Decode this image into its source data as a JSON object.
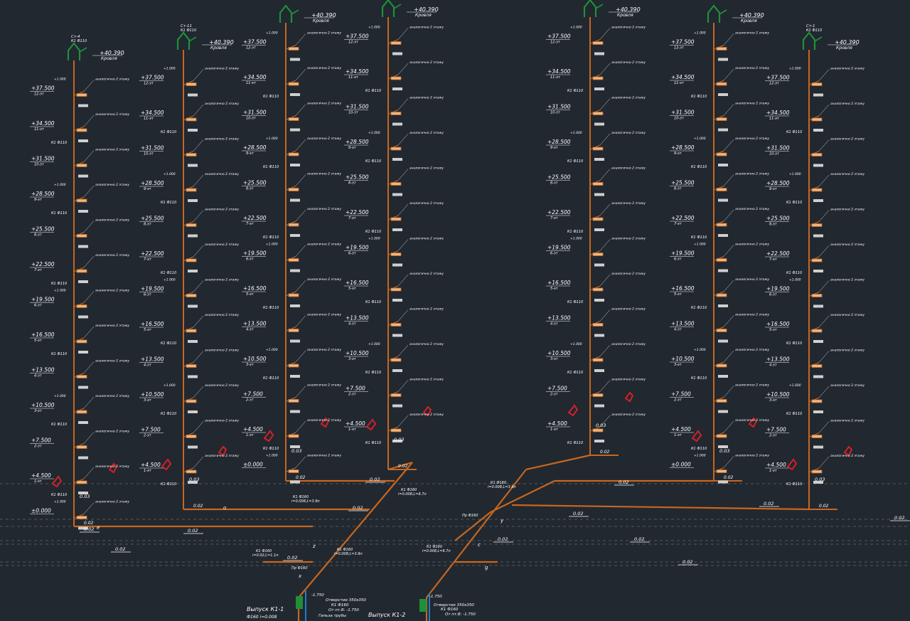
{
  "drawing": {
    "background": "#212830",
    "pipe_color": "#c8661e",
    "equipment_color": "#d42027",
    "vent_color": "#1f8f3a",
    "text_color": "#ffffff",
    "dim_color": "#bdbdbd"
  },
  "level_labels": [
    "+40.390",
    "+37.500",
    "+34.500",
    "+31.500",
    "+28.500",
    "+25.500",
    "+22.500",
    "+19.500",
    "+16.500",
    "+13.500",
    "+10.500",
    "+7.500",
    "+4.500",
    "±0.000"
  ],
  "roof_caption": "Кровля",
  "floor_captions": [
    "12-эт",
    "11-эт",
    "10-эт",
    "9-эт",
    "8-эт",
    "7-эт",
    "6-эт",
    "5-эт",
    "4-эт",
    "3-эт",
    "2-эт",
    "1-эт"
  ],
  "pipe_label": "К1 Ф110",
  "pipe_label_small": "К1 Ф50",
  "connection_note": "аналогично 2 этажу",
  "riser_tags": [
    "Ст-4",
    "Ст-11",
    "Ст-1"
  ],
  "riser_size": "К1 Ф110",
  "floor_mark": "+1.000",
  "slope_labels": [
    "0.02",
    "0.03"
  ],
  "outlet_1": {
    "title": "Выпуск К1-1",
    "size": "Ф160 i=0.008"
  },
  "outlet_2": {
    "title": "Выпуск К1-2",
    "size": "Ф160 i=0.008"
  },
  "outlet_notes": [
    "Отверстие 350х350",
    "К1 Ф160",
    "От пт.В: -1.750",
    "Гильза трубы",
    "-1.750"
  ],
  "branch_notes": [
    "К1 Ф160",
    "i=0.008,L=3.9п",
    "i=0.008,L=6.7п",
    "i=0.02,L=1.1п",
    "Пр Ф160"
  ],
  "point_letters": [
    "x",
    "y",
    "z",
    "g",
    "c",
    "e",
    "o"
  ]
}
